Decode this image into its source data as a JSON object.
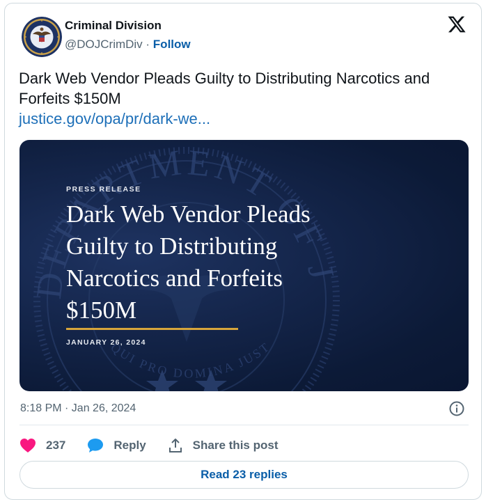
{
  "author": {
    "name": "Criminal Division",
    "handle": "@DOJCrimDiv",
    "separator": " · ",
    "follow_label": "Follow",
    "avatar_icon": "doj-seal-avatar"
  },
  "platform_icon": "x-logo-icon",
  "tweet": {
    "text": "Dark Web Vendor Pleads Guilty to Distributing Narcotics and Forfeits $150M",
    "link": "justice.gov/opa/pr/dark-we..."
  },
  "media": {
    "label": "PRESS RELEASE",
    "headline": "Dark Web Vendor Pleads Guilty to Distributing Narcotics and Forfeits $150M",
    "date": "JANUARY 26, 2024",
    "seal_text": "DEPARTMENT OF JUSTICE",
    "seal_motto": "QUI PRO DOMINA JUSTITIA SEQUITUR",
    "colors": {
      "background": "#0e1d3d",
      "accent": "#d6a53b"
    }
  },
  "timestamp": "8:18 PM · Jan 26, 2024",
  "actions": {
    "like_count": "237",
    "reply_label": "Reply",
    "share_label": "Share this post"
  },
  "read_replies_label": "Read 23 replies",
  "colors": {
    "link": "#1d6fb8",
    "like": "#f91880",
    "reply_icon": "#1d9bf0",
    "text": "#0f1419",
    "muted": "#536471"
  }
}
